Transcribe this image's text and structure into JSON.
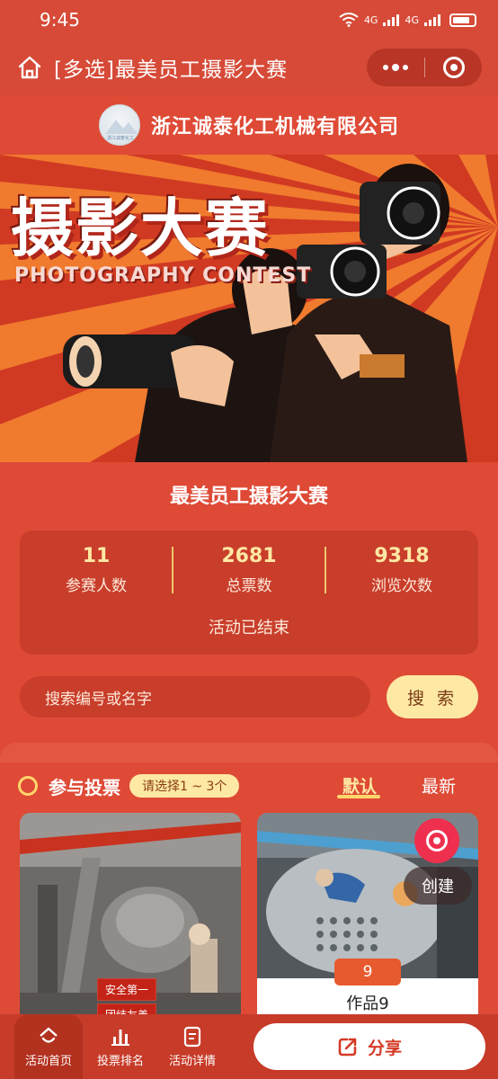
{
  "status_bar": {
    "time": "9:45",
    "network_1": "4G",
    "network_2": "4G"
  },
  "nav": {
    "title": "[多选]最美员工摄影大赛"
  },
  "company": {
    "name": "浙江诚泰化工机械有限公司",
    "logo_text": "浙江诚泰化工"
  },
  "banner": {
    "title": "摄影大赛",
    "subtitle": "PHOTOGRAPHY CONTEST"
  },
  "activity": {
    "title": "最美员工摄影大赛",
    "status": "活动已结束",
    "stats": [
      {
        "value": "11",
        "label": "参赛人数"
      },
      {
        "value": "2681",
        "label": "总票数"
      },
      {
        "value": "9318",
        "label": "浏览次数"
      }
    ]
  },
  "search": {
    "placeholder": "搜索编号或名字",
    "button": "搜 索"
  },
  "vote": {
    "title": "参与投票",
    "hint": "请选择1 ~ 3个",
    "sort_default": "默认",
    "sort_new": "最新"
  },
  "entries": [
    {
      "badge_1": "安全第一",
      "badge_2": "团结友善"
    },
    {
      "number": "9",
      "name": "作品9"
    }
  ],
  "create": {
    "label": "创建"
  },
  "tabbar": {
    "home": "活动首页",
    "ranking": "投票排名",
    "details": "活动详情",
    "share": "分享"
  },
  "colors": {
    "primary": "#de4a36",
    "accent_yellow": "#fde8a4",
    "dark_red": "#c93d2b"
  }
}
